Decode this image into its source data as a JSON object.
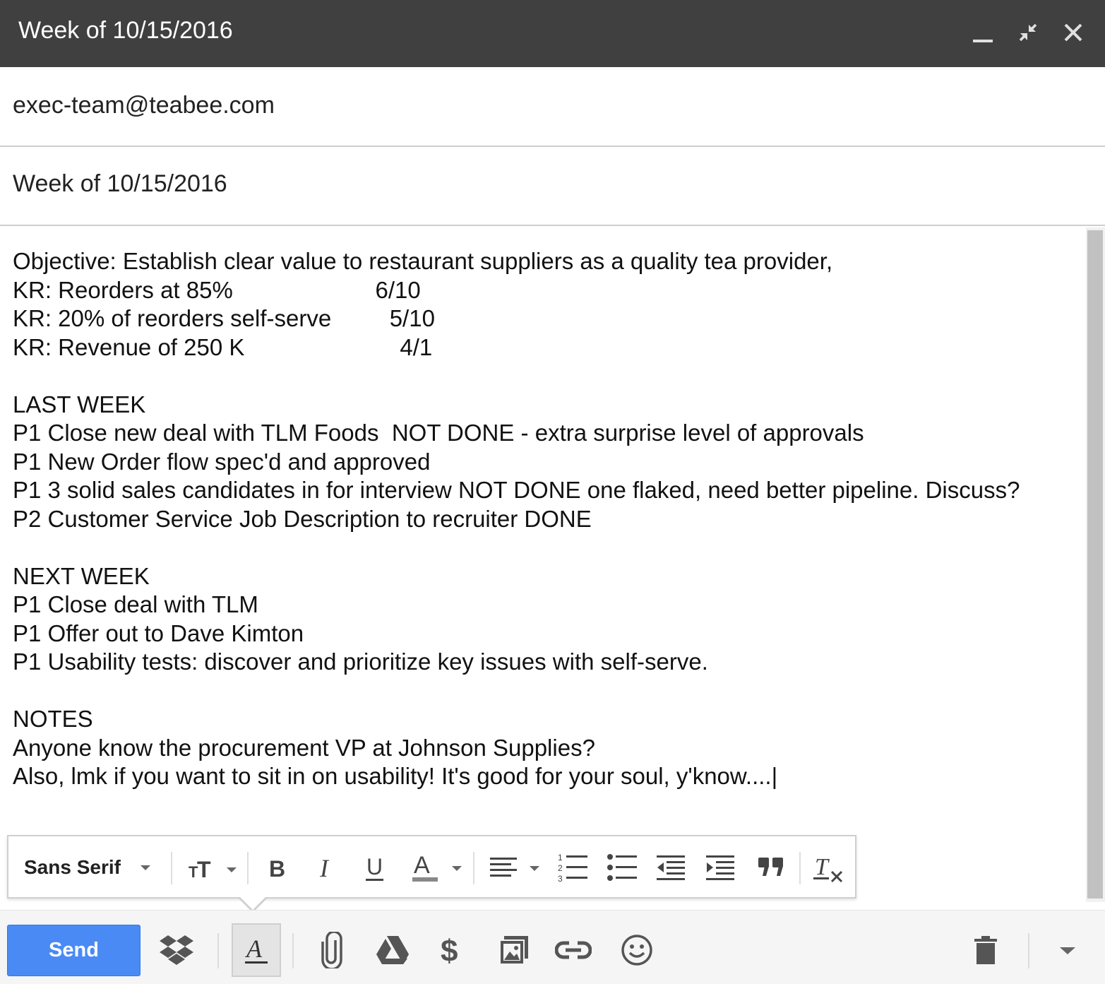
{
  "window": {
    "title": "Week of 10/15/2016",
    "minimize_icon": "minimize-icon",
    "popout_icon": "exit-fullscreen-icon",
    "close_icon": "close-icon"
  },
  "to": {
    "value": "exec-team@teabee.com"
  },
  "subject": {
    "value": "Week of 10/15/2016"
  },
  "body": {
    "text": "Objective: Establish clear value to restaurant suppliers as a quality tea provider,\nKR: Reorders at 85%                      6/10\nKR: 20% of reorders self-serve         5/10\nKR: Revenue of 250 K                        4/1\n\nLAST WEEK\nP1 Close new deal with TLM Foods  NOT DONE - extra surprise level of approvals\nP1 New Order flow spec'd and approved\nP1 3 solid sales candidates in for interview NOT DONE one flaked, need better pipeline. Discuss?\nP2 Customer Service Job Description to recruiter DONE\n\nNEXT WEEK\nP1 Close deal with TLM\nP1 Offer out to Dave Kimton\nP1 Usability tests: discover and prioritize key issues with self-serve.\n\nNOTES\nAnyone know the procurement VP at Johnson Supplies?\nAlso, lmk if you want to sit in on usability! It's good for your soul, y'know....|"
  },
  "formatting": {
    "font_family": "Sans Serif",
    "icons": [
      "text-size-icon",
      "bold-icon",
      "italic-icon",
      "underline-icon",
      "text-color-icon",
      "align-icon",
      "numbered-list-icon",
      "bulleted-list-icon",
      "indent-less-icon",
      "indent-more-icon",
      "quote-icon",
      "remove-formatting-icon"
    ]
  },
  "toolbar": {
    "send_label": "Send",
    "icons": [
      "dropbox-icon",
      "formatting-options-icon",
      "attach-icon",
      "drive-icon",
      "money-icon",
      "photo-icon",
      "link-icon",
      "emoji-icon",
      "trash-icon",
      "more-options-icon"
    ]
  },
  "colors": {
    "titlebar": "#404040",
    "send_button": "#4a8af4"
  }
}
